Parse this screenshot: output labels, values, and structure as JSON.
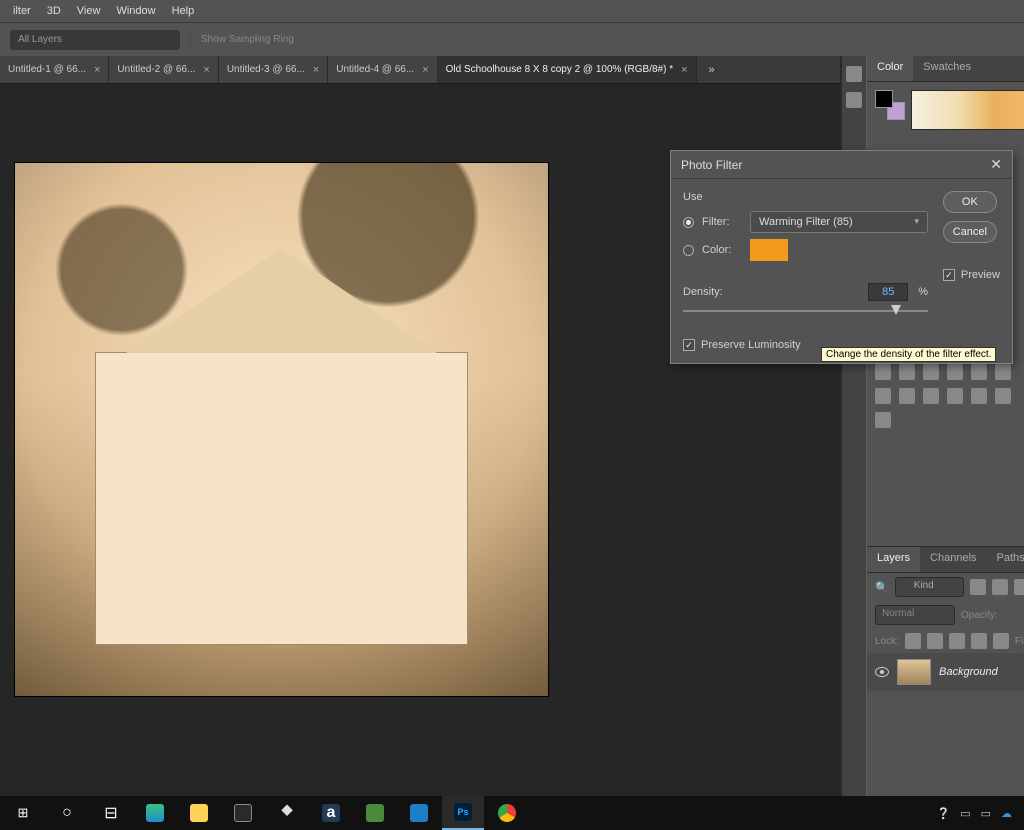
{
  "menu": {
    "items": [
      "ilter",
      "3D",
      "View",
      "Window",
      "Help"
    ]
  },
  "options": {
    "sample": "All Layers",
    "ring": "Show Sampling Ring"
  },
  "tabs": {
    "list": [
      {
        "label": "Untitled-1 @ 66..."
      },
      {
        "label": "Untitled-2 @ 66..."
      },
      {
        "label": "Untitled-3 @ 66..."
      },
      {
        "label": "Untitled-4 @ 66..."
      },
      {
        "label": "Old Schoolhouse 8 X 8 copy 2 @ 100% (RGB/8#) *"
      }
    ],
    "more": "»"
  },
  "panels": {
    "color_tab": "Color",
    "swatches_tab": "Swatches",
    "layers_tab": "Layers",
    "channels_tab": "Channels",
    "paths_tab": "Paths",
    "search_placeholder": "Kind",
    "blend_mode": "Normal",
    "opacity": "Opacity:",
    "lock": "Lock:",
    "fill": "Fill:",
    "layer_name": "Background"
  },
  "dialog": {
    "title": "Photo Filter",
    "use": "Use",
    "filter_label": "Filter:",
    "filter_value": "Warming Filter (85)",
    "color_label": "Color:",
    "ok": "OK",
    "cancel": "Cancel",
    "preview": "Preview",
    "density_label": "Density:",
    "density_value": "85",
    "percent": "%",
    "preserve": "Preserve Luminosity",
    "tooltip": "Change the density of the filter effect.",
    "swatch_color": "#f29a1a"
  }
}
